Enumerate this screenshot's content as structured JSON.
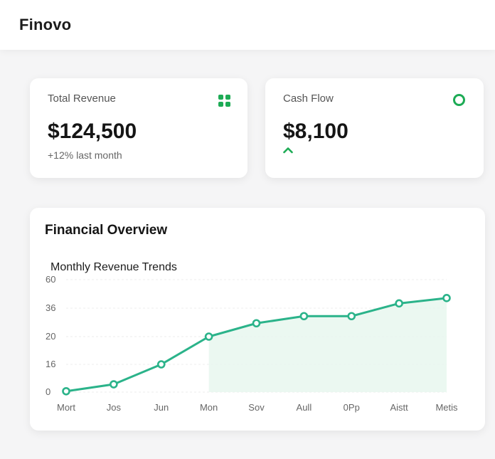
{
  "app": {
    "name": "Finovo"
  },
  "cards": {
    "revenue": {
      "label": "Total Revenue",
      "value": "$124,500",
      "sub": "+12% last month",
      "icon": "grid-icon"
    },
    "cashflow": {
      "label": "Cash Flow",
      "value": "$8,100",
      "trend": "up",
      "icon": "circle-icon"
    }
  },
  "overview": {
    "title": "Financial Overview"
  },
  "colors": {
    "accent": "#1dab55",
    "line": "#2bb38a",
    "area": "#e8f7ef"
  },
  "chart_data": {
    "type": "line",
    "title": "Monthly Revenue Trends",
    "xlabel": "",
    "ylabel": "",
    "categories": [
      "Mort",
      "Jos",
      "Jun",
      "Mon",
      "Sov",
      "Aull",
      "0Pp",
      "Aistt",
      "Metis"
    ],
    "y_ticks": [
      "0",
      "16",
      "20",
      "36",
      "60"
    ],
    "values": [
      0.5,
      4.5,
      16,
      20,
      27.5,
      31.5,
      31.5,
      40,
      44.5
    ],
    "ylim": [
      0,
      60
    ],
    "shaded_from_index": 3,
    "grid": true,
    "legend": "none"
  }
}
